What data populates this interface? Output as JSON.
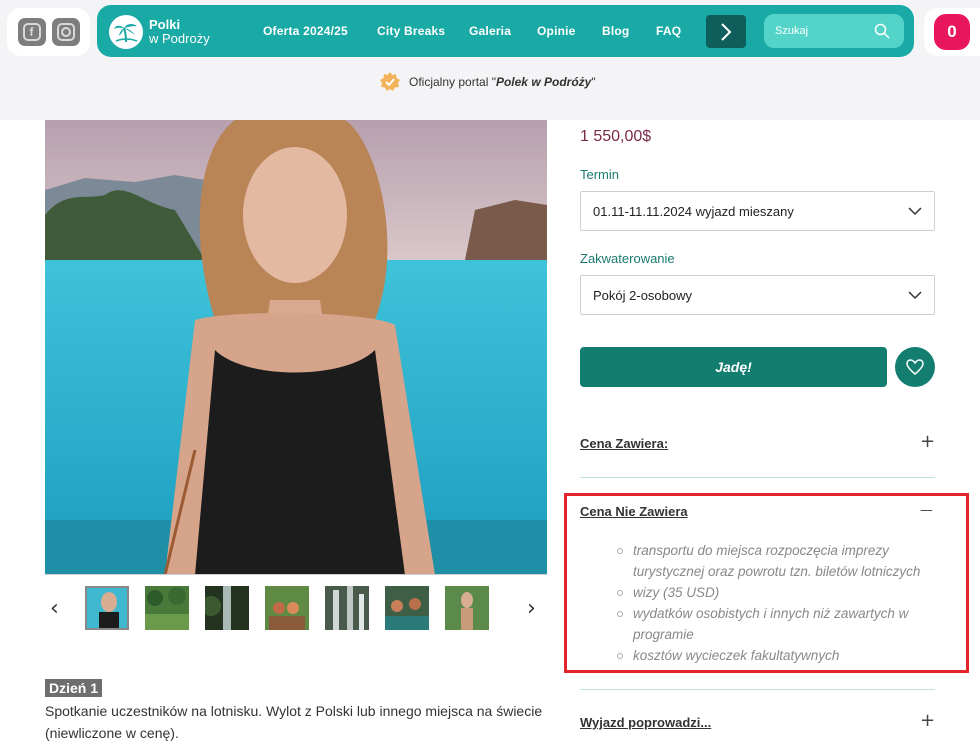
{
  "header": {
    "social": [
      {
        "icon": "facebook-icon",
        "glyph": "f"
      },
      {
        "icon": "instagram-icon",
        "glyph": ""
      }
    ],
    "logo": {
      "line1": "Polki",
      "line2": "w Podroży"
    },
    "nav_items": [
      "Oferta 2024/25",
      "City Breaks",
      "Galeria",
      "Opinie",
      "Blog",
      "FAQ"
    ],
    "search_placeholder": "Szukaj",
    "cart_count": "0",
    "accent_color": "#1aaaa6"
  },
  "official": {
    "prefix": "Oficjalny portal \"",
    "brand": "Polek w Podróży",
    "suffix": "\""
  },
  "gallery": {
    "prev": "‹",
    "next": "›",
    "thumb_count": 7
  },
  "itinerary": {
    "day_label": "Dzień 1",
    "day_text": "Spotkanie uczestników na lotnisku. Wylot z Polski lub innego miejsca na świecie (niewliczone w cenę)."
  },
  "booking": {
    "price": "1 550,00$",
    "term_label": "Termin",
    "term_value": "01.11-11.11.2024 wyjazd mieszany",
    "accommodation_label": "Zakwaterowanie",
    "accommodation_value": "Pokój 2-osobowy",
    "go_button": "Jadę!"
  },
  "accordion": {
    "included": {
      "title": "Cena Zawiera:",
      "toggle": "+"
    },
    "excluded": {
      "title": "Cena Nie Zawiera",
      "toggle": "—",
      "items": [
        "transportu do miejsca rozpoczęcia imprezy turystycznej oraz powrotu tzn. biletów lotniczych",
        "wizy (35 USD)",
        "wydatków osobistych i innych niż zawartych w programie",
        "kosztów wycieczek fakultatywnych"
      ]
    },
    "guide": {
      "title": "Wyjazd poprowadzi...",
      "toggle": "+"
    }
  },
  "highlight_color": "#e3262e"
}
